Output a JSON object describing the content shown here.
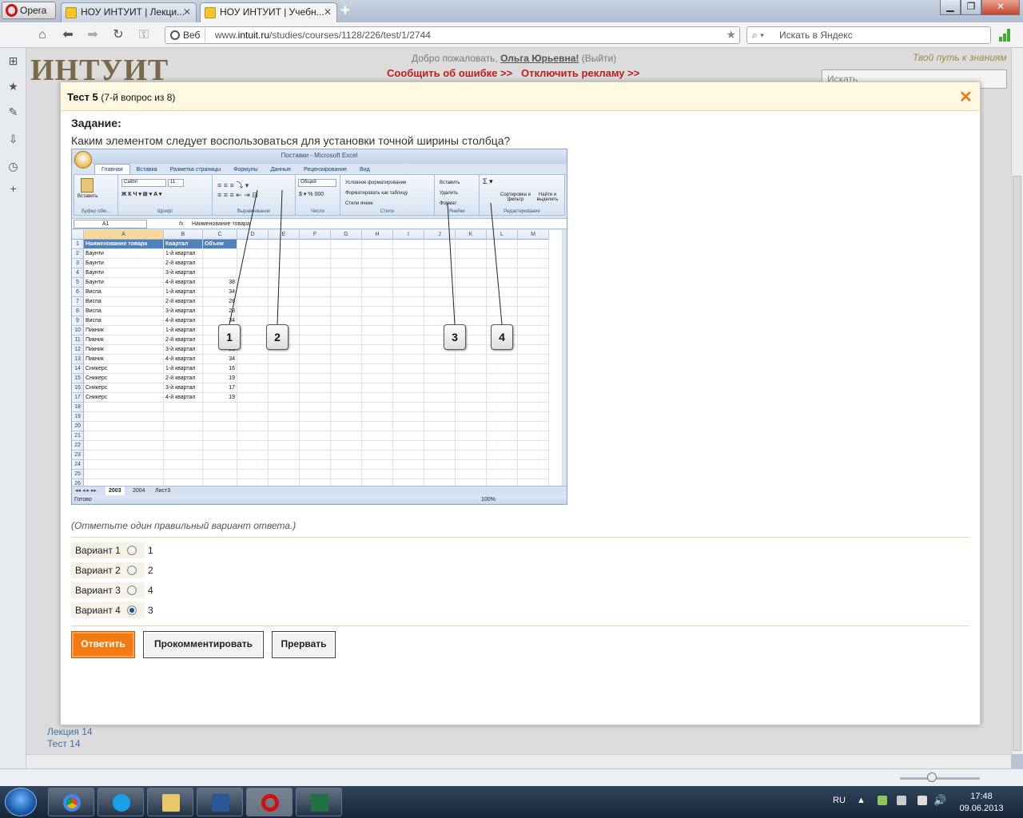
{
  "browser": {
    "menu_label": "Opera",
    "tabs": [
      {
        "title": "НОУ ИНТУИТ | Лекци...",
        "active": false
      },
      {
        "title": "НОУ ИНТУИТ | Учебн...",
        "active": true
      }
    ],
    "web_badge": "Веб",
    "url_prefix": "www.",
    "url_domain": "intuit.ru",
    "url_path": "/studies/courses/1128/226/test/1/2744",
    "search_placeholder": "Искать в Яндекс"
  },
  "site": {
    "logo": "ИНТУИТ",
    "welcome_prefix": "Добро пожаловать,",
    "user_name": "Ольга Юрьевна!",
    "logout": "(Выйти)",
    "report_error": "Сообщить об ошибке >>",
    "disable_ads": "Отключить рекламу >>",
    "slogan": "Твой путь к знаниям",
    "search_placeholder": "Искать",
    "sidebar": [
      "Лекция 14",
      "Тест 14"
    ]
  },
  "test": {
    "title": "Тест 5",
    "subtitle": "(7-й вопрос из 8)",
    "task_label": "Задание:",
    "question": "Каким элементом следует воспользоваться для установки точной ширины столбца?",
    "hint": "(Отметьте один правильный вариант ответа.)",
    "options": [
      {
        "label": "Вариант 1",
        "value": "1",
        "selected": false
      },
      {
        "label": "Вариант 2",
        "value": "2",
        "selected": false
      },
      {
        "label": "Вариант 3",
        "value": "4",
        "selected": false
      },
      {
        "label": "Вариант 4",
        "value": "3",
        "selected": true
      }
    ],
    "buttons": {
      "answer": "Ответить",
      "comment": "Прокомментировать",
      "abort": "Прервать"
    }
  },
  "excel": {
    "window_title": "Поставки - Microsoft Excel",
    "ribbon_tabs": [
      "Главная",
      "Вставка",
      "Разметка страницы",
      "Формулы",
      "Данные",
      "Рецензирование",
      "Вид"
    ],
    "groups": [
      "Буфер обм...",
      "Шрифт",
      "Выравнивание",
      "Число",
      "Стили",
      "Ячейки",
      "Редактирование"
    ],
    "cells_buttons": [
      "Вставить",
      "Удалить",
      "Формат"
    ],
    "font_name": "Calibri",
    "font_size": "11",
    "number_format": "Общий",
    "styles_buttons": [
      "Условное форматирование",
      "Форматировать как таблицу",
      "Стили ячеек"
    ],
    "edit_buttons": [
      "Сортировка и фильтр",
      "Найти и выделить"
    ],
    "paste_label": "Вставить",
    "cell_ref": "A1",
    "formula": "Наименование товара",
    "columns": [
      "A",
      "B",
      "C",
      "D",
      "E",
      "F",
      "G",
      "H",
      "I",
      "J",
      "K",
      "L",
      "M"
    ],
    "headers": [
      "Наименование товара",
      "Квартал",
      "Объем"
    ],
    "rows": [
      [
        "Баунти",
        "1-й квартал",
        ""
      ],
      [
        "Баунти",
        "2-й квартал",
        ""
      ],
      [
        "Баунти",
        "3-й квартал",
        ""
      ],
      [
        "Баунти",
        "4-й квартал",
        "38"
      ],
      [
        "Виспа",
        "1-й квартал",
        "34"
      ],
      [
        "Виспа",
        "2-й квартал",
        "28"
      ],
      [
        "Виспа",
        "3-й квартал",
        "28"
      ],
      [
        "Виспа",
        "4-й квартал",
        "34"
      ],
      [
        "Пикник",
        "1-й квартал",
        "45"
      ],
      [
        "Пикник",
        "2-й квартал",
        "34"
      ],
      [
        "Пикник",
        "3-й квартал",
        "21"
      ],
      [
        "Пикник",
        "4-й квартал",
        "34"
      ],
      [
        "Сникерс",
        "1-й квартал",
        "16"
      ],
      [
        "Сникерс",
        "2-й квартал",
        "19"
      ],
      [
        "Сникерс",
        "3-й квартал",
        "17"
      ],
      [
        "Сникерс",
        "4-й квартал",
        "19"
      ]
    ],
    "callouts": [
      "1",
      "2",
      "3",
      "4"
    ],
    "sheets": [
      "2003",
      "2004",
      "Лист3"
    ],
    "status": "Готово",
    "zoom": "100%"
  },
  "taskbar": {
    "lang": "RU",
    "time": "17:48",
    "date": "09.06.2013"
  }
}
